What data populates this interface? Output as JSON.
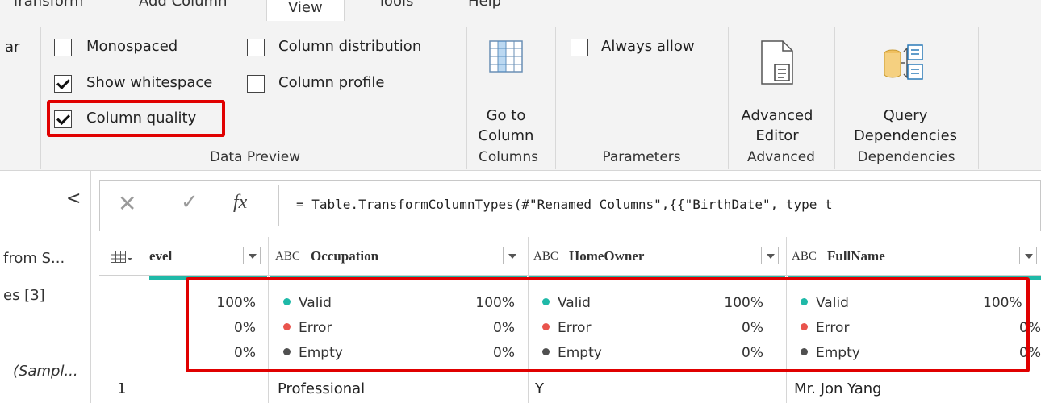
{
  "tabs": [
    "Transform",
    "Add Column",
    "View",
    "Tools",
    "Help"
  ],
  "ribbon": {
    "partial_left": "ar",
    "checkboxes": {
      "monospaced": {
        "label": "Monospaced",
        "checked": false
      },
      "show_whitespace": {
        "label": "Show whitespace",
        "checked": true
      },
      "column_quality": {
        "label": "Column quality",
        "checked": true
      },
      "column_distribution": {
        "label": "Column distribution",
        "checked": false
      },
      "column_profile": {
        "label": "Column profile",
        "checked": false
      },
      "always_allow": {
        "label": "Always allow",
        "checked": false
      }
    },
    "go_to_column": [
      "Go to",
      "Column"
    ],
    "advanced_editor": [
      "Advanced",
      "Editor"
    ],
    "query_dependencies": [
      "Query",
      "Dependencies"
    ],
    "groups": {
      "data_preview": "Data Preview",
      "columns": "Columns",
      "parameters": "Parameters",
      "advanced": "Advanced",
      "dependencies": "Dependencies"
    }
  },
  "left_pane": {
    "collapse_glyph": "<",
    "items": [
      "from S...",
      "es [3]",
      "(Sampl..."
    ]
  },
  "formula_bar": {
    "cancel_glyph": "✕",
    "commit_glyph": "✓",
    "fx": "fx",
    "formula": "= Table.TransformColumnTypes(#\"Renamed Columns\",{{\"BirthDate\", type t"
  },
  "grid": {
    "columns": [
      {
        "name": "evel"
      },
      {
        "name": "Occupation"
      },
      {
        "name": "HomeOwner"
      },
      {
        "name": "FullName"
      }
    ],
    "type_icon": "ABC",
    "quality_labels": {
      "valid": "Valid",
      "error": "Error",
      "empty": "Empty"
    },
    "quality_colors": {
      "valid": "#1fb9a8",
      "error": "#e9544d",
      "empty": "#505050"
    },
    "quality": [
      {
        "valid": "100%",
        "error": "0%",
        "empty": "0%"
      },
      {
        "valid": "100%",
        "error": "0%",
        "empty": "0%"
      },
      {
        "valid": "100%",
        "error": "0%",
        "empty": "0%"
      },
      {
        "valid": "100%",
        "error": "0%",
        "empty": "0%"
      }
    ],
    "rows": [
      {
        "index": "1",
        "cells": [
          "",
          "Professional",
          "Y",
          "Mr. Jon Yang"
        ]
      }
    ]
  }
}
